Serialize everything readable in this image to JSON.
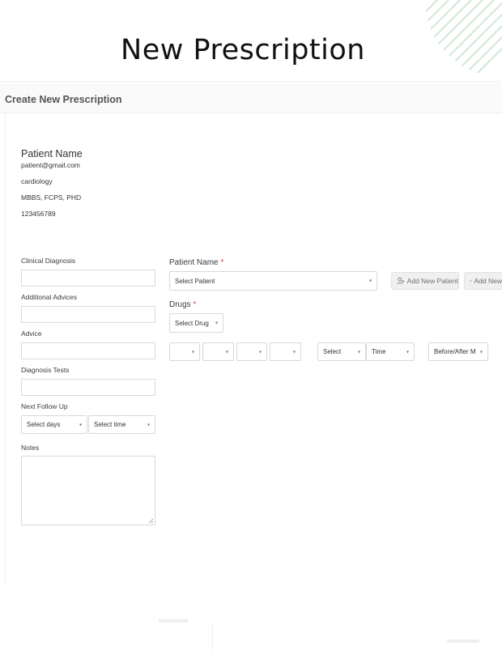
{
  "page": {
    "hero_title": "New Prescription",
    "header_title": "Create New Prescription"
  },
  "patient": {
    "name": "Patient Name",
    "email": "patient@gmail.com",
    "specialty": "cardiology",
    "degrees": "MBBS, FCPS, PHD",
    "phone": "123456789"
  },
  "left_form": {
    "clinical_diagnosis_label": "Clinical Diagnosis",
    "additional_advices_label": "Additional Advices",
    "advice_label": "Advice",
    "diagnosis_tests_label": "Diagnosis Tests",
    "next_follow_up_label": "Next Follow Up",
    "select_days": "Select days",
    "select_time": "Select time",
    "notes_label": "Notes"
  },
  "right_form": {
    "patient_name_label": "Patient Name",
    "required_mark": "*",
    "select_patient": "Select Patient",
    "add_new_patient": "Add New Patient",
    "add_new_truncated": "Add New",
    "drugs_label": "Drugs",
    "select_drug": "Select Drug",
    "dose_select": "Select",
    "time_select": "Time",
    "meal_select": "Before/After M"
  },
  "icons": {
    "caret": "▾",
    "user_add": "user-add-icon",
    "plus_circle": "plus-circle-icon"
  },
  "colors": {
    "required": "#e53935",
    "accent_stripes": "#cfe8d6"
  }
}
